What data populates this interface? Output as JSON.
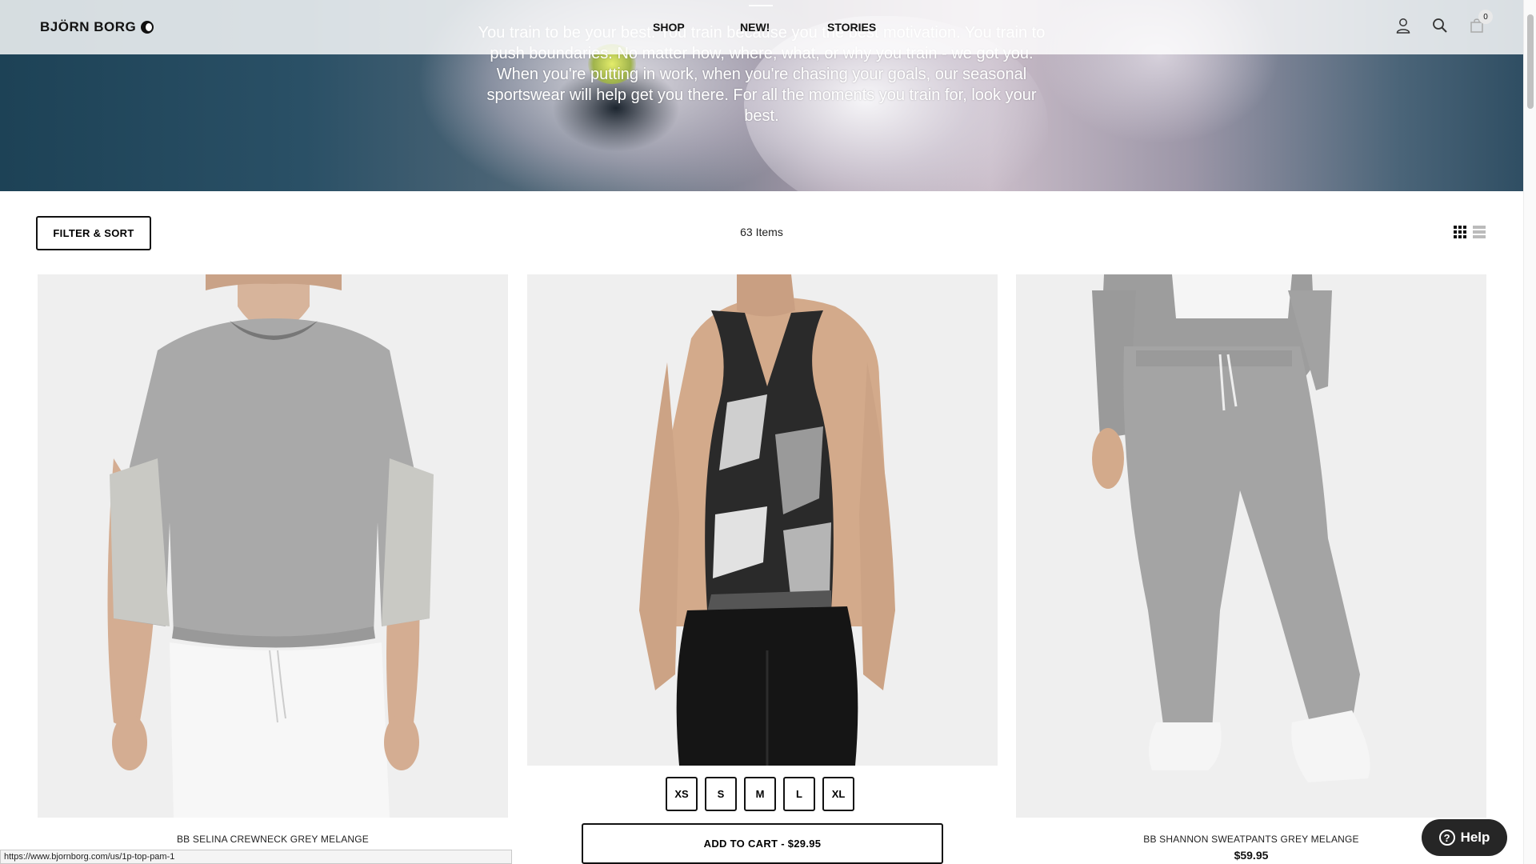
{
  "header": {
    "logo": "BJÖRN BORG",
    "nav": [
      {
        "label": "SHOP"
      },
      {
        "label": "NEW!"
      },
      {
        "label": "STORIES"
      }
    ],
    "cart_count": "0",
    "icons": [
      "user-icon",
      "search-icon",
      "bag-icon"
    ]
  },
  "hero": {
    "text": "You train to be your best. You train because you the best motivation. You train to push boundaries. No matter how, where, what, or why you train - we got you. When you're putting in work, when you're chasing your goals, our seasonal sportswear will help get you there. For all the moments you train for, look your best."
  },
  "toolbar": {
    "filter_label": "FILTER & SORT",
    "items_count": "63 Items",
    "view_modes": [
      "grid-view-icon",
      "list-view-icon"
    ]
  },
  "products": [
    {
      "name": "BB SELINA CREWNECK GREY MELANGE",
      "price": ""
    },
    {
      "name": "",
      "price": "",
      "sizes": [
        "XS",
        "S",
        "M",
        "L",
        "XL"
      ],
      "add_to_cart": "ADD TO CART - $29.95"
    },
    {
      "name": "BB SHANNON SWEATPANTS GREY MELANGE",
      "price": "$59.95"
    }
  ],
  "help": {
    "label": "Help"
  },
  "status_url": "https://www.bjornborg.com/us/1p-top-pam-1",
  "colors": {
    "accent": "#111111",
    "help_bg": "#262626",
    "hero_blue": "#1d4256"
  }
}
